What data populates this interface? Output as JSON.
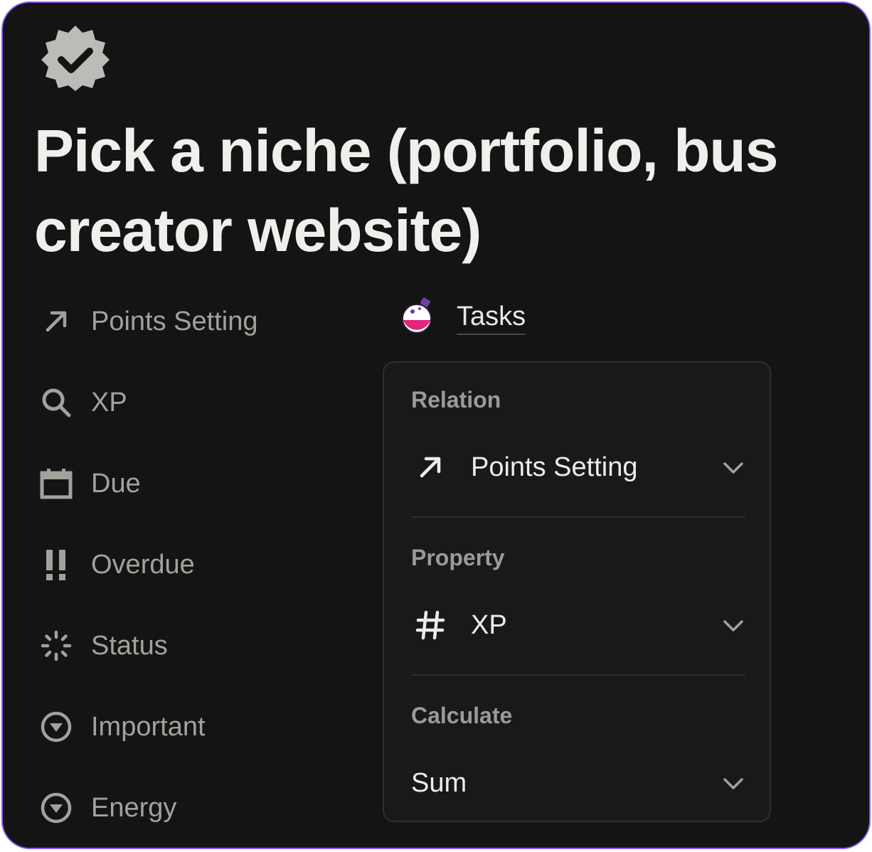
{
  "page": {
    "icon": "verified-badge-icon",
    "title_line1": "Pick a niche (portfolio, bus",
    "title_line2": "creator website)"
  },
  "properties": [
    {
      "label": "Points Setting",
      "icon": "arrow-up-right-icon"
    },
    {
      "label": "XP",
      "icon": "search-icon"
    },
    {
      "label": "Due",
      "icon": "calendar-icon"
    },
    {
      "label": "Overdue",
      "icon": "exclamation-icon"
    },
    {
      "label": "Status",
      "icon": "loading-spinner-icon"
    },
    {
      "label": "Important",
      "icon": "chevron-circle-icon"
    },
    {
      "label": "Energy",
      "icon": "chevron-circle-icon"
    }
  ],
  "tasks_link": {
    "label": "Tasks",
    "icon": "potion-flask-icon"
  },
  "rollup_panel": {
    "relation": {
      "label": "Relation",
      "value": "Points Setting",
      "icon": "arrow-up-right-icon"
    },
    "property": {
      "label": "Property",
      "value": "XP",
      "icon": "hash-icon"
    },
    "calculate": {
      "label": "Calculate",
      "value": "Sum"
    }
  },
  "colors": {
    "background": "#141414",
    "frame_border": "#8b5cf6",
    "title_text": "#f0efec",
    "muted_text": "#a3a19c",
    "panel_bg": "#191919"
  }
}
